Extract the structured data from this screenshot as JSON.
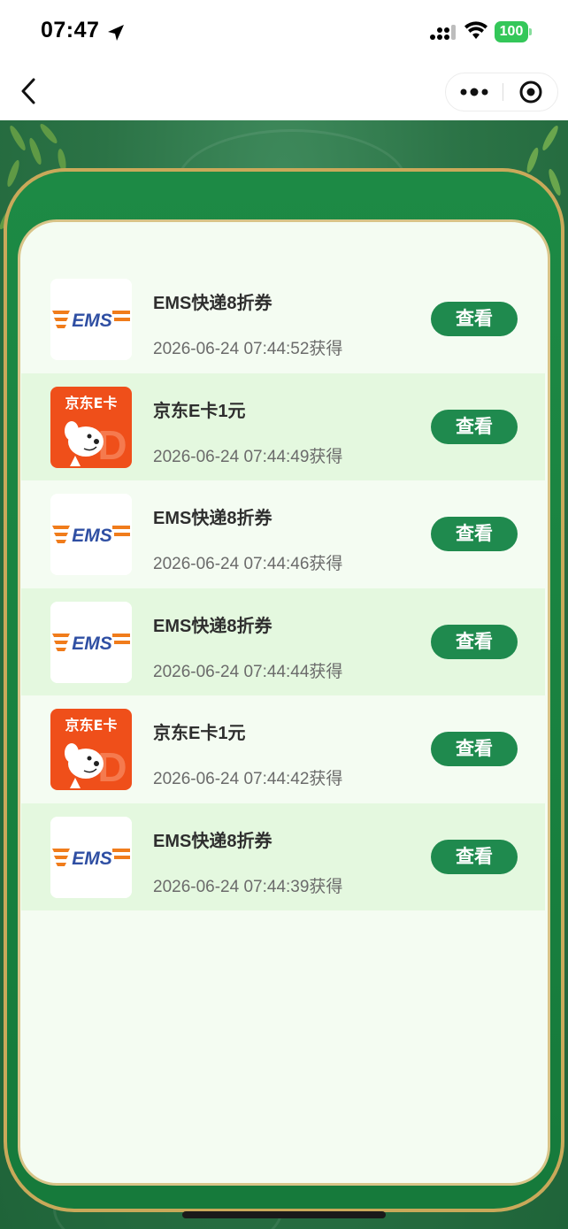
{
  "status_bar": {
    "time": "07:47",
    "battery": "100"
  },
  "colors": {
    "accent": "#1f8a4e",
    "row_alt": "#e4f8df",
    "panel_bg": "#f4fcf2",
    "frame": "#1d8a45",
    "gold": "#c9a95a"
  },
  "items": [
    {
      "icon": "ems-logo-icon",
      "title": "EMS快递8折券",
      "date": "2026-06-24 07:44:52获得",
      "button": "查看"
    },
    {
      "icon": "jd-ecard-icon",
      "title": "京东E卡1元",
      "date": "2026-06-24 07:44:49获得",
      "button": "查看"
    },
    {
      "icon": "ems-logo-icon",
      "title": "EMS快递8折券",
      "date": "2026-06-24 07:44:46获得",
      "button": "查看"
    },
    {
      "icon": "ems-logo-icon",
      "title": "EMS快递8折券",
      "date": "2026-06-24 07:44:44获得",
      "button": "查看"
    },
    {
      "icon": "jd-ecard-icon",
      "title": "京东E卡1元",
      "date": "2026-06-24 07:44:42获得",
      "button": "查看"
    },
    {
      "icon": "ems-logo-icon",
      "title": "EMS快递8折券",
      "date": "2026-06-24 07:44:39获得",
      "button": "查看"
    }
  ]
}
